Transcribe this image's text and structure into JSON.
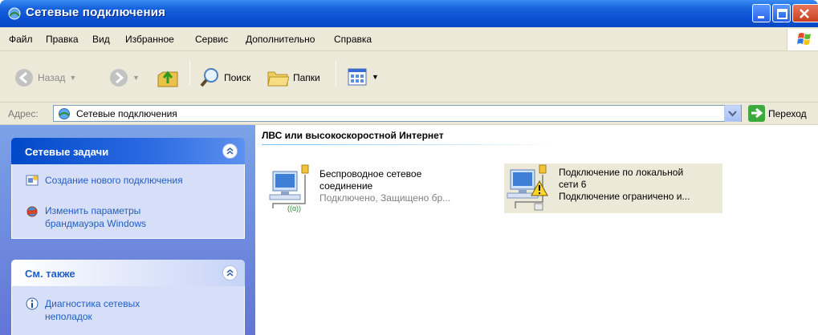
{
  "window": {
    "title": "Сетевые подключения"
  },
  "menu": {
    "items": [
      "Файл",
      "Правка",
      "Вид",
      "Избранное",
      "Сервис",
      "Дополнительно",
      "Справка"
    ]
  },
  "toolbar": {
    "back_label": "Назад",
    "search_label": "Поиск",
    "folders_label": "Папки"
  },
  "address": {
    "label": "Адрес:",
    "value": "Сетевые подключения",
    "go_label": "Переход"
  },
  "sidebar": {
    "tasks_panel": {
      "title": "Сетевые задачи",
      "items": [
        {
          "label": "Создание нового подключения",
          "icon": "new-connection-icon"
        },
        {
          "label": "Изменить параметры брандмауэра Windows",
          "icon": "firewall-icon"
        }
      ]
    },
    "see_also_panel": {
      "title": "См. также",
      "items": [
        {
          "label": "Диагностика сетевых неполадок",
          "icon": "info-icon"
        }
      ]
    }
  },
  "content": {
    "group_title": "ЛВС или высокоскоростной Интернет",
    "connections": [
      {
        "name_line1": "Беспроводное сетевое",
        "name_line2": "соединение",
        "status": "Подключено, Защищено бр..."
      },
      {
        "name_line1": "Подключение по локальной",
        "name_line2": "сети 6",
        "status": "Подключение ограничено и..."
      }
    ]
  },
  "colors": {
    "titlebar": "#0b4fd0",
    "link": "#215dc6",
    "sidebar_bg": "#6f8ddf",
    "chrome": "#ece9d8"
  }
}
